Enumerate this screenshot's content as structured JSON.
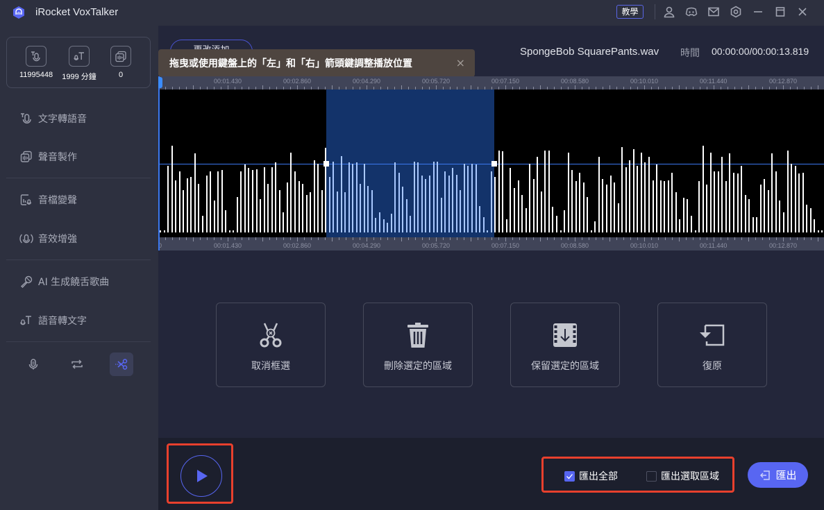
{
  "app": {
    "title": "iRocket VoxTalker",
    "tutorial_label": "教學",
    "titlebar_icons": [
      "user-icon",
      "discord-icon",
      "mail-icon",
      "settings-icon",
      "minimize-icon",
      "maximize-icon",
      "close-icon"
    ]
  },
  "sidebar": {
    "stats": [
      {
        "icon": "text-to-speech-count-icon",
        "value": "11995448"
      },
      {
        "icon": "speech-to-text-minutes-icon",
        "value": "1999 分鐘"
      },
      {
        "icon": "voice-clone-count-icon",
        "value": "0"
      }
    ],
    "nav": [
      {
        "icon": "text-to-speech-icon",
        "label": "文字轉語音"
      },
      {
        "icon": "voice-production-icon",
        "label": "聲音製作"
      },
      {
        "icon": "voice-changer-icon",
        "label": "音檔變聲"
      },
      {
        "icon": "audio-enhance-icon",
        "label": "音效增強"
      },
      {
        "icon": "ai-song-icon",
        "label": "AI 生成饒舌歌曲"
      },
      {
        "icon": "speech-to-text-icon",
        "label": "語音轉文字"
      }
    ],
    "modes": [
      {
        "icon": "microphone-icon",
        "active": false
      },
      {
        "icon": "convert-icon",
        "active": false
      },
      {
        "icon": "scissors-icon",
        "active": true
      }
    ]
  },
  "editor": {
    "hidden_button_label": "更改添加",
    "tooltip": "拖曳或使用鍵盤上的「左」和「右」箭頭鍵調整播放位置",
    "tooltip_close": "×",
    "file_name": "SpongeBob SquarePants.wav",
    "time_label": "時間",
    "time_value": "00:00:00/00:00:13.819",
    "ruler_labels": [
      "00:01.430",
      "00:02.860",
      "00:04.290",
      "00:05.720",
      "00:07.150",
      "00:08.580",
      "00:10.010",
      "00:11.440",
      "00:12.870"
    ],
    "ruler_bottom_start": "0",
    "duration_seconds": 13.819,
    "selection_seconds": [
      3.46,
      6.92
    ],
    "playhead_seconds": 0,
    "waveform": [
      0.02,
      0.02,
      0.6,
      0.78,
      0.47,
      0.55,
      0.38,
      0.49,
      0.5,
      0.71,
      0.44,
      0.15,
      0.51,
      0.55,
      0.29,
      0.55,
      0.56,
      0.2,
      0.02,
      0.02,
      0.32,
      0.55,
      0.61,
      0.58,
      0.56,
      0.57,
      0.3,
      0.59,
      0.44,
      0.59,
      0.63,
      0.38,
      0.18,
      0.45,
      0.72,
      0.55,
      0.46,
      0.44,
      0.34,
      0.36,
      0.65,
      0.62,
      0.38,
      0.76,
      0.5,
      0.64,
      0.37,
      0.69,
      0.36,
      0.63,
      0.62,
      0.63,
      0.44,
      0.62,
      0.42,
      0.38,
      0.13,
      0.18,
      0.12,
      0.09,
      0.17,
      0.63,
      0.54,
      0.41,
      0.3,
      0.15,
      0.64,
      0.63,
      0.51,
      0.48,
      0.51,
      0.64,
      0.64,
      0.31,
      0.55,
      0.51,
      0.58,
      0.52,
      0.38,
      0.62,
      0.6,
      0.62,
      0.61,
      0.24,
      0.14,
      0.02,
      0.55,
      0.5,
      0.74,
      0.73,
      0.12,
      0.58,
      0.4,
      0.47,
      0.34,
      0.22,
      0.62,
      0.48,
      0.68,
      0.37,
      0.74,
      0.74,
      0.23,
      0.15,
      0.02,
      0.2,
      0.72,
      0.56,
      0.46,
      0.54,
      0.45,
      0.32,
      0.02,
      0.1,
      0.68,
      0.48,
      0.43,
      0.51,
      0.45,
      0.26,
      0.77,
      0.59,
      0.65,
      0.75,
      0.6,
      0.72,
      0.63,
      0.68,
      0.47,
      0.61,
      0.47,
      0.46,
      0.47,
      0.54,
      0.36,
      0.12,
      0.31,
      0.3,
      0.15,
      0.02,
      0.46,
      0.78,
      0.43,
      0.72,
      0.55,
      0.55,
      0.68,
      0.46,
      0.71,
      0.54,
      0.53,
      0.6,
      0.34,
      0.3,
      0.14,
      0.14,
      0.43,
      0.48,
      0.38,
      0.71,
      0.55,
      0.29,
      0.18,
      0.74,
      0.62,
      0.6,
      0.53,
      0.54,
      0.25,
      0.22,
      0.12,
      0.02,
      0.02
    ]
  },
  "actions": [
    {
      "icon": "cancel-selection-scissors-icon",
      "label": "取消框選"
    },
    {
      "icon": "trash-icon",
      "label": "刪除選定的區域"
    },
    {
      "icon": "keep-selection-film-icon",
      "label": "保留選定的區域"
    },
    {
      "icon": "restore-icon",
      "label": "復原"
    }
  ],
  "bottom": {
    "play_icon": "play-icon",
    "export_all_label": "匯出全部",
    "export_all_checked": true,
    "export_selection_label": "匯出選取區域",
    "export_selection_checked": false,
    "export_button_label": "匯出",
    "highlight_color": "#e8402d",
    "accent_color": "#5866f2"
  }
}
